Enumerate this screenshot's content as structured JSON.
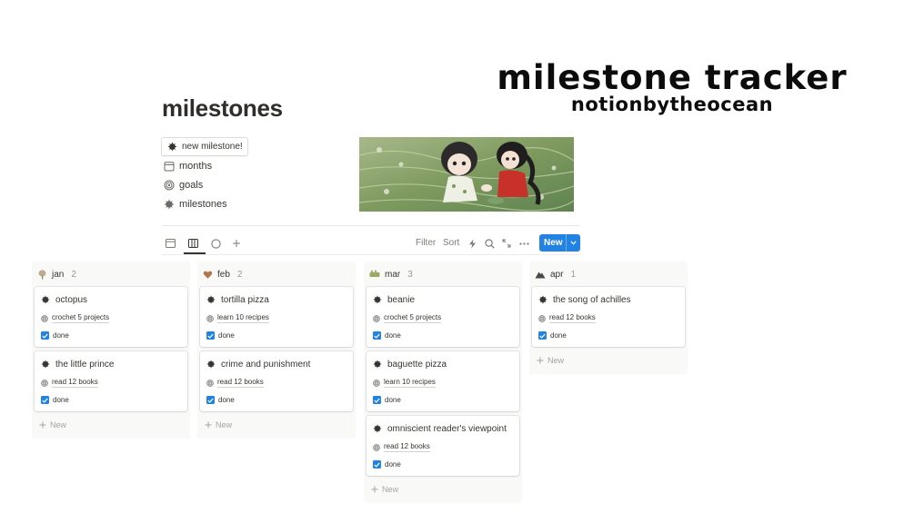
{
  "promo": {
    "title": "milestone tracker",
    "subtitle": "notionbytheocean"
  },
  "page": {
    "title": "milestones"
  },
  "quick_links": {
    "new_button": "new milestone!",
    "items": [
      {
        "label": "months",
        "icon": "calendar-icon"
      },
      {
        "label": "goals",
        "icon": "target-icon"
      },
      {
        "label": "milestones",
        "icon": "sunburst-icon"
      }
    ]
  },
  "toolbar": {
    "views": [
      "table-view-icon",
      "board-view-icon",
      "circle-view-icon",
      "plus-icon"
    ],
    "filter": "Filter",
    "sort": "Sort",
    "new_label": "New"
  },
  "board": {
    "add_new_label": "New",
    "columns": [
      {
        "name": "jan",
        "count": "2",
        "icon": "tree-icon",
        "cards": [
          {
            "title": "octopus",
            "goal": "crochet 5 projects",
            "status": "done"
          },
          {
            "title": "the little prince",
            "goal": "read 12 books",
            "status": "done"
          }
        ]
      },
      {
        "name": "feb",
        "count": "2",
        "icon": "heart-bird-icon",
        "cards": [
          {
            "title": "tortilla pizza",
            "goal": "learn 10 recipes",
            "status": "done"
          },
          {
            "title": "crime and punishment",
            "goal": "read 12 books",
            "status": "done"
          }
        ]
      },
      {
        "name": "mar",
        "count": "3",
        "icon": "grass-icon",
        "cards": [
          {
            "title": "beanie",
            "goal": "crochet 5 projects",
            "status": "done"
          },
          {
            "title": "baguette pizza",
            "goal": "learn 10 recipes",
            "status": "done"
          },
          {
            "title": "omniscient reader's viewpoint",
            "goal": "read 12 books",
            "status": "done"
          }
        ]
      },
      {
        "name": "apr",
        "count": "1",
        "icon": "mountain-icon",
        "cards": [
          {
            "title": "the song of achilles",
            "goal": "read 12 books",
            "status": "done"
          }
        ]
      }
    ]
  },
  "colors": {
    "accent": "#2383e2",
    "text": "#37352f",
    "muted": "#9b9a97"
  }
}
